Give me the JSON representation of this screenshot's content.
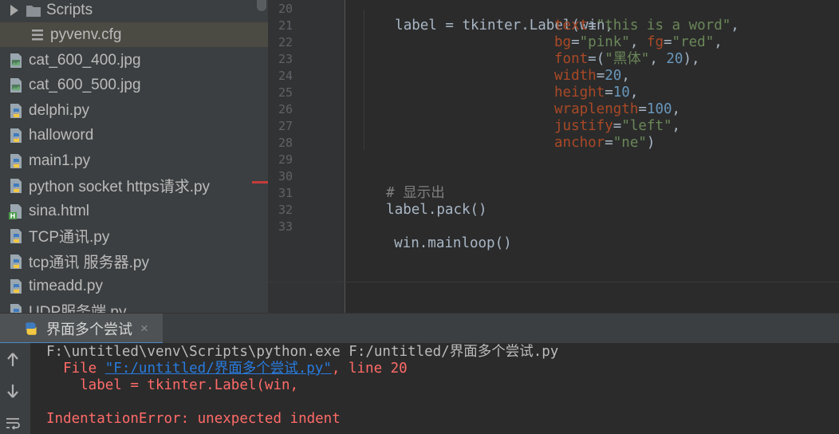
{
  "project_tree": {
    "items": [
      {
        "label": "Scripts",
        "type": "folder",
        "icon": "folder-icon"
      },
      {
        "label": "pyvenv.cfg",
        "type": "config",
        "icon": "config-file-icon"
      },
      {
        "label": "cat_600_400.jpg",
        "type": "image",
        "icon": "image-file-icon"
      },
      {
        "label": "cat_600_500.jpg",
        "type": "image",
        "icon": "image-file-icon"
      },
      {
        "label": "delphi.py",
        "type": "python",
        "icon": "python-file-icon"
      },
      {
        "label": "halloword",
        "type": "python",
        "icon": "python-file-icon"
      },
      {
        "label": "main1.py",
        "type": "python",
        "icon": "python-file-icon"
      },
      {
        "label": "python socket https请求.py",
        "type": "python",
        "icon": "python-file-icon"
      },
      {
        "label": "sina.html",
        "type": "html",
        "icon": "html-file-icon"
      },
      {
        "label": "TCP通讯.py",
        "type": "python",
        "icon": "python-file-icon"
      },
      {
        "label": "tcp通讯 服务器.py",
        "type": "python",
        "icon": "python-file-icon"
      },
      {
        "label": "timeadd.py",
        "type": "python",
        "icon": "python-file-icon"
      },
      {
        "label": "UDP服务端.py",
        "type": "python",
        "icon": "python-file-icon"
      }
    ]
  },
  "editor": {
    "line_numbers": [
      "20",
      "21",
      "22",
      "23",
      "24",
      "25",
      "26",
      "27",
      "28",
      "29",
      "30",
      "31",
      "32",
      "33"
    ],
    "l20": {
      "a": "label = tkinter.Label(win,"
    },
    "l21": {
      "param": "text",
      "eq": "=",
      "str": "\"this is a word\"",
      "comma": ","
    },
    "l22": {
      "param1": "bg",
      "eq1": "=",
      "str1": "\"pink\"",
      "sep": ", ",
      "param2": "fg",
      "eq2": "=",
      "str2": "\"red\"",
      "comma": ","
    },
    "l23": {
      "param": "font",
      "eq": "=(",
      "str": "\"黑体\"",
      "sep": ", ",
      "num": "20",
      "close": "),"
    },
    "l24": {
      "param": "width",
      "eq": "=",
      "num": "20",
      "comma": ","
    },
    "l25": {
      "param": "height",
      "eq": "=",
      "num": "10",
      "comma": ","
    },
    "l26": {
      "param": "wraplength",
      "eq": "=",
      "num": "100",
      "comma": ","
    },
    "l27": {
      "param": "justify",
      "eq": "=",
      "str": "\"left\"",
      "comma": ","
    },
    "l28": {
      "param": "anchor",
      "eq": "=",
      "str": "\"ne\"",
      "close": ")"
    },
    "l30": {
      "comment": "# 显示出"
    },
    "l31": {
      "a": "label.pack()"
    },
    "l33": {
      "a": "win.mainloop()"
    }
  },
  "run_panel": {
    "tab_title": "界面多个尝试",
    "close_glyph": "×",
    "console": {
      "cmd": "F:\\untitled\\venv\\Scripts\\python.exe F:/untitled/界面多个尝试.py",
      "file_prefix": "  File ",
      "file_link": "\"F:/untitled/界面多个尝试.py\"",
      "file_suffix": ", line 20",
      "source_line": "    label = tkinter.Label(win,",
      "error": "IndentationError: unexpected indent"
    }
  },
  "colors": {
    "param": "#aa4926",
    "string": "#6a8759",
    "number": "#6897bb",
    "error": "#ff6b68",
    "link": "#287bde"
  }
}
